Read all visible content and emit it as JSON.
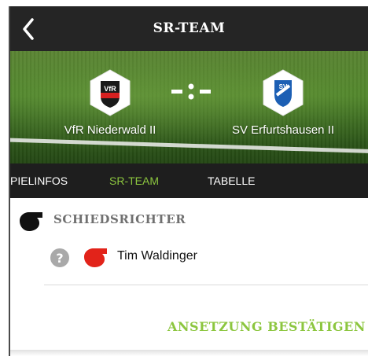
{
  "header": {
    "title": "SR-TEAM",
    "back_icon": "chevron-left-icon"
  },
  "match": {
    "home_team": {
      "name": "VfR Niederwald II",
      "badge_text": "VfR"
    },
    "away_team": {
      "name": "SV Erfurtshausen II",
      "badge_text": "SV"
    },
    "score": "-:-"
  },
  "tabs": [
    {
      "label": "SPIELINFOS",
      "visible_label": "PIELINFOS",
      "active": false
    },
    {
      "label": "SR-TEAM",
      "active": true
    },
    {
      "label": "TABELLE",
      "active": false
    }
  ],
  "section": {
    "title": "SCHIEDSRICHTER",
    "icon": "whistle-icon"
  },
  "referees": [
    {
      "name": "Tim Waldinger",
      "status_icon": "question-icon",
      "role_icon": "red-whistle-icon"
    }
  ],
  "actions": {
    "confirm_label": "ANSETZUNG BESTÄTIGEN"
  },
  "colors": {
    "accent": "#8cc63f",
    "topbar": "#252525",
    "tabs": "#1e1e1e",
    "whistle_red": "#e2231a",
    "away_blue": "#1c5fb4"
  }
}
